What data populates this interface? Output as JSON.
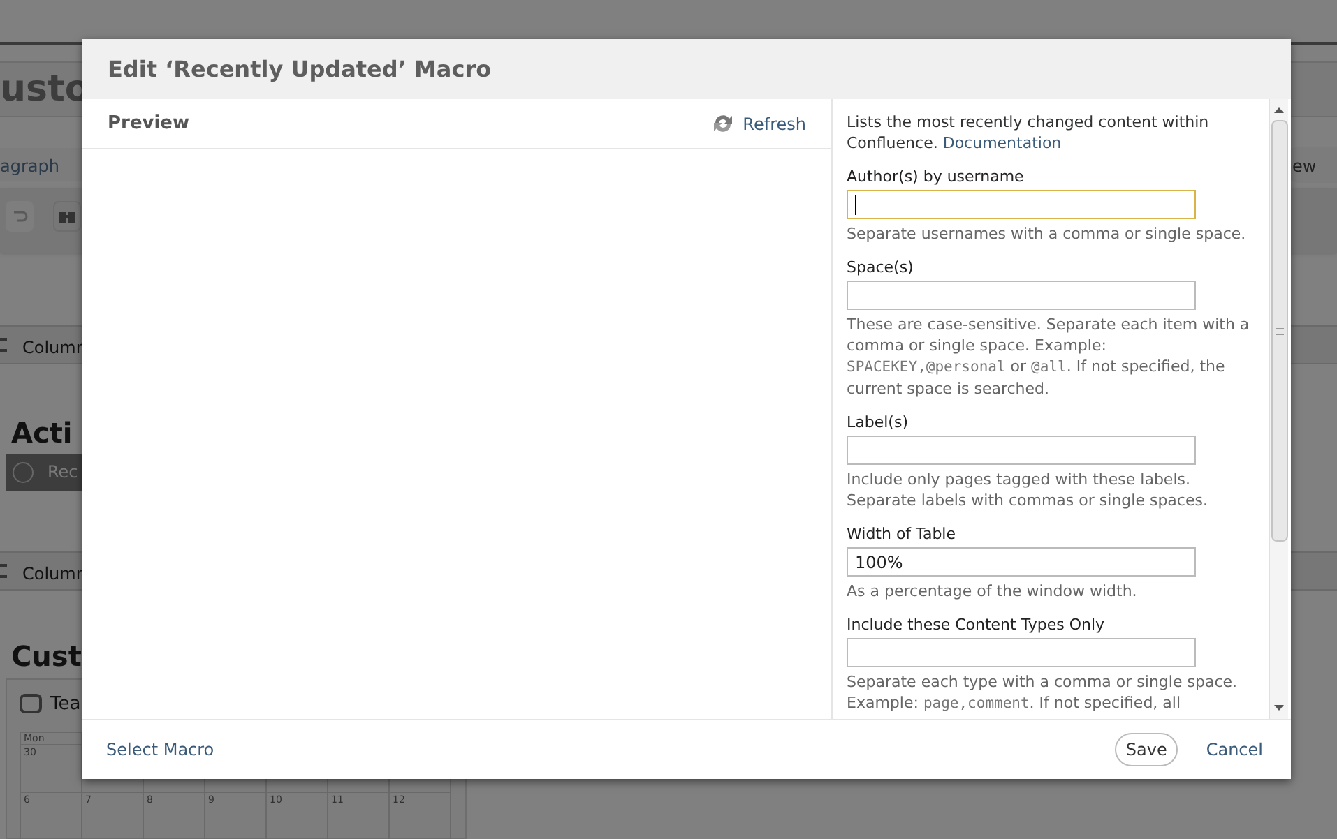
{
  "background": {
    "heading": "usto",
    "toolbar_label": "agraph",
    "section_1": "Column",
    "activity_heading": "Acti",
    "activity_tab": "Rec",
    "section_2": "Column",
    "custom_heading": "Cust",
    "calendar_title": "Tea",
    "button_fragment": "ew",
    "calendar_days": [
      "Mon"
    ],
    "calendar_row_1": [
      "30"
    ],
    "calendar_row_2": [
      "6",
      "7",
      "8",
      "9",
      "10",
      "11",
      "12"
    ]
  },
  "dialog": {
    "title": "Edit ‘Recently Updated’ Macro",
    "preview": {
      "label": "Preview",
      "refresh": "Refresh"
    },
    "description": {
      "text": "Lists the most recently changed content within Confluence.",
      "link": "Documentation"
    },
    "fields": [
      {
        "label": "Author(s) by username",
        "focused": true,
        "help": [
          {
            "kind": "text",
            "text": "Separate usernames with a comma or single space."
          }
        ]
      },
      {
        "label": "Space(s)",
        "focused": false,
        "help": [
          {
            "kind": "text",
            "text": "These are case-sensitive. Separate each item with a comma or single space. Example: "
          },
          {
            "kind": "code",
            "text": "SPACEKEY,@personal"
          },
          {
            "kind": "text",
            "text": " or "
          },
          {
            "kind": "code",
            "text": "@all"
          },
          {
            "kind": "text",
            "text": ". If not specified, the current space is searched."
          }
        ]
      },
      {
        "label": "Label(s)",
        "focused": false,
        "help": [
          {
            "kind": "text",
            "text": "Include only pages tagged with these labels. Separate labels with commas or single spaces."
          }
        ]
      },
      {
        "label": "Width of Table",
        "value": "100%",
        "focused": false,
        "help": [
          {
            "kind": "text",
            "text": "As a percentage of the window width."
          }
        ]
      },
      {
        "label": "Include these Content Types Only",
        "focused": false,
        "help": [
          {
            "kind": "text",
            "text": "Separate each type with a comma or single space. Example: "
          },
          {
            "kind": "code",
            "text": "page,comment"
          },
          {
            "kind": "text",
            "text": ". If not specified, all"
          }
        ]
      }
    ],
    "footer": {
      "select_macro": "Select Macro",
      "save": "Save",
      "cancel": "Cancel"
    }
  }
}
